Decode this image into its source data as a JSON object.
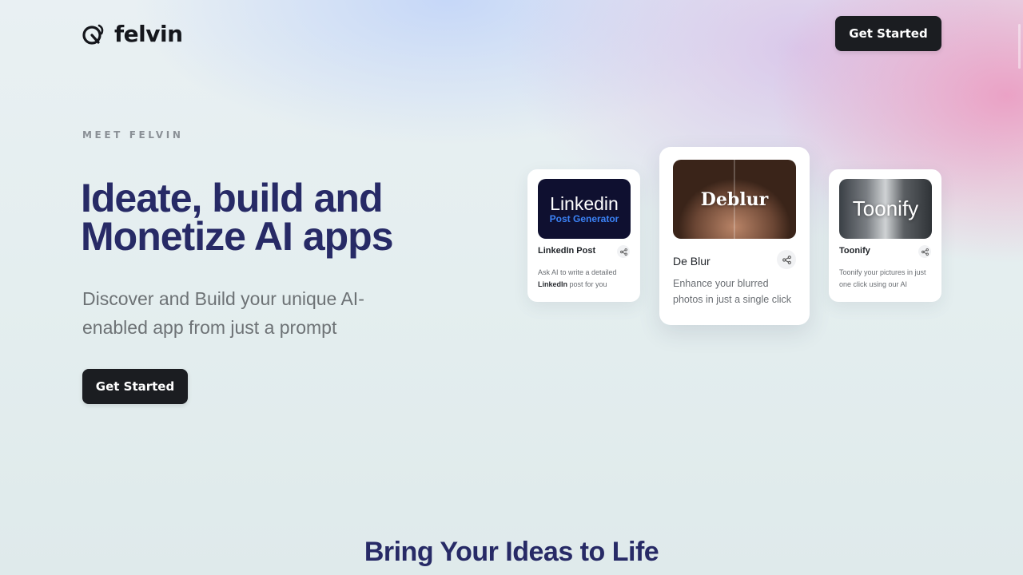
{
  "brand": {
    "name": "felvin"
  },
  "nav": {
    "cta_label": "Get Started"
  },
  "hero": {
    "eyebrow": "MEET FELVIN",
    "title_line1": "Ideate, build and",
    "title_line2": "Monetize AI apps",
    "subtitle": "Discover and Build your unique AI-enabled app from just a prompt",
    "cta_label": "Get Started"
  },
  "apps": [
    {
      "thumb_line1": "Linkedin",
      "thumb_line2": "Post Generator",
      "title": "LinkedIn Post",
      "desc_pre": "Ask AI to write a detailed ",
      "desc_bold": "LinkedIn",
      "desc_post": " post for you"
    },
    {
      "thumb_line1": "Deblur",
      "title": "De Blur",
      "desc": "Enhance your blurred photos in just a single click"
    },
    {
      "thumb_line1": "Toonify",
      "title": "Toonify",
      "desc": "Toonify your pictures in just one click using our AI"
    }
  ],
  "section": {
    "title": "Bring Your Ideas to Life"
  },
  "icons": {
    "logo": "felvin-logo-icon",
    "share": "share-icon"
  },
  "colors": {
    "accent_dark": "#1b1d21",
    "headline": "#272a66",
    "linkedin_blue": "#3b82f6"
  }
}
